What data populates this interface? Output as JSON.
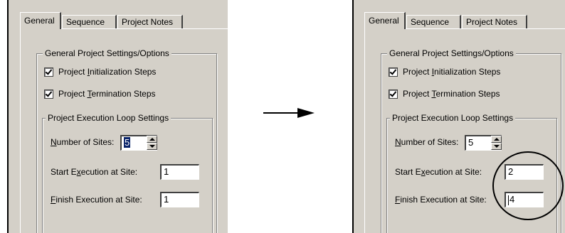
{
  "tabs": [
    "General",
    "Sequence",
    "Project Notes"
  ],
  "general_group": {
    "legend": "General Project Settings/Options",
    "init_steps": {
      "prefix": "Project ",
      "accel": "I",
      "rest": "nitialization Steps",
      "checked": true
    },
    "term_steps": {
      "prefix": "Project ",
      "accel": "T",
      "rest": "ermination Steps",
      "checked": true
    }
  },
  "loop_group": {
    "legend": "Project Execution Loop Settings",
    "sites_label": {
      "accel": "N",
      "rest": "umber of Sites:"
    },
    "start_label": {
      "prefix": "Start E",
      "accel": "x",
      "rest": "ecution at Site:"
    },
    "finish_label": {
      "accel": "F",
      "rest": "inish Execution at Site:"
    }
  },
  "before": {
    "number_of_sites": "5",
    "start_site": "1",
    "finish_site": "1"
  },
  "after": {
    "number_of_sites": "5",
    "start_site": "2",
    "finish_site": "4"
  },
  "colors": {
    "dialog_face": "#d4d0c8",
    "selection": "#0a246a"
  },
  "icons": [
    "arrow-right-icon",
    "highlight-circle"
  ]
}
